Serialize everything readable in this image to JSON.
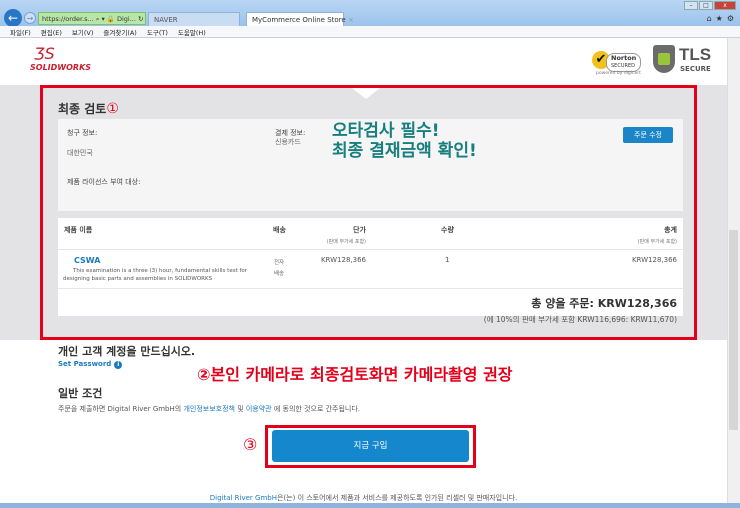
{
  "browser": {
    "address": "https://order.s... ⌕ ▾ 🔒 Digi... ↻",
    "tabs": [
      {
        "label": "NAVER"
      },
      {
        "label": "MyCommerce Online Store"
      }
    ],
    "tab_close": "×",
    "menu": [
      "파일(F)",
      "편집(E)",
      "보기(V)",
      "즐겨찾기(A)",
      "도구(T)",
      "도움말(H)"
    ]
  },
  "header": {
    "logo": "SOLIDWORKS",
    "norton": {
      "brand": "Norton",
      "sub": "SECURED",
      "powered": "powered by digicert"
    },
    "tls": {
      "title": "TLS",
      "sub": "SECURE"
    }
  },
  "review": {
    "title": "최종 검토",
    "marker": "①",
    "billing_label": "청구 정보:",
    "billing_value": "대한민국",
    "payment_label": "결제 정보:",
    "payment_value": "신용카드",
    "license_label": "제품 라이선스 부여 대상:",
    "edit_button": "주문 수정",
    "memo_line1": "오타검사 필수!",
    "memo_line2": "최종 결재금액 확인!"
  },
  "table": {
    "headers": {
      "name": "제품 이름",
      "delivery": "배송",
      "price": "단가",
      "price_sub": "(판매 부가세 포함)",
      "qty": "수량",
      "total": "총계",
      "total_sub": "(판매 부가세 포함)"
    },
    "rows": [
      {
        "name": "CSWA",
        "desc1": "This examination is a three (3) hour, fundamental skills test for",
        "desc2": "designing basic parts and assemblies in SOLIDWORKS",
        "delivery1": "전자",
        "delivery2": "배송",
        "price": "KRW128,366",
        "qty": "1",
        "total": "KRW128,366"
      }
    ],
    "order_total": "총 양을 주문:  KRW128,366",
    "vat": "(에 10%의 판매 부가세 포함 KRW116,696: KRW11,670)"
  },
  "account": {
    "title": "개인 고객 계정을 만드십시오.",
    "set_password": "Set Password",
    "info_icon": "i"
  },
  "memo2": "②본인 카메라로 최종검토화면 카메라촬영 권장",
  "terms": {
    "title": "일반 조건",
    "text_pre": "주문을 제출하면 Digital River GmbH의 ",
    "privacy": "개인정보보호정책",
    "and": " 및 ",
    "tos": "이용약관",
    "text_post": " 에 동의한 것으로 간주됩니다."
  },
  "buy": {
    "marker": "③",
    "label": "지금 구입"
  },
  "footer": {
    "link": "Digital River GmbH",
    "text": "은(는) 이 스토어에서 제품과 서비스를 제공하도록 인가된 리셀러 및 판매자입니다."
  },
  "colors": {
    "accent": "#1587cc",
    "annotation_red": "#e2001a",
    "annotation_teal": "#17807f"
  }
}
